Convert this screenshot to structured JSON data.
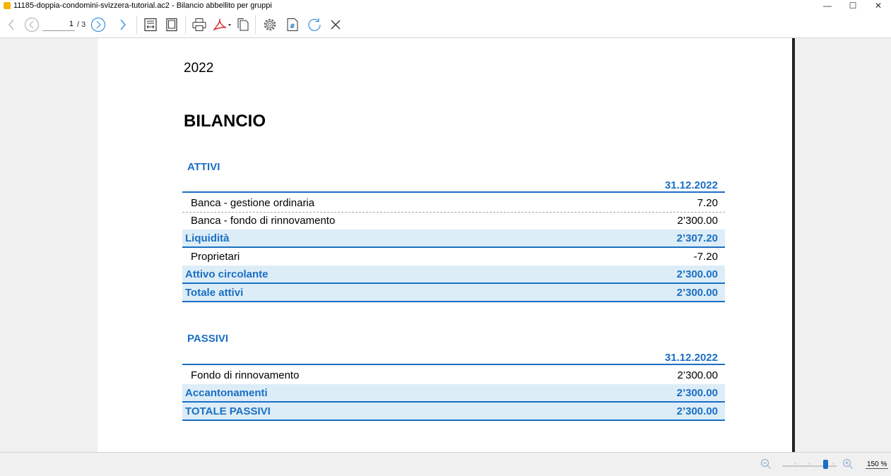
{
  "window": {
    "title": "11185-doppia-condomini-svizzera-tutorial.ac2 - Bilancio abbellito per gruppi",
    "controls": {
      "minimize": "—",
      "maximize": "☐",
      "close": "✕"
    }
  },
  "toolbar": {
    "page_current": "1",
    "page_total": "/ 3",
    "icons": [
      "back-icon",
      "previous-page-icon",
      "next-page-icon",
      "forward-icon",
      "fit-width-icon",
      "fit-page-icon",
      "print-icon",
      "pdf-export-icon",
      "copy-icon",
      "settings-icon",
      "page-number-icon",
      "refresh-icon",
      "close-icon"
    ],
    "accent": "#1a6fc4"
  },
  "document": {
    "year": "2022",
    "title": "BILANCIO",
    "attivi": {
      "heading": "ATTIVI",
      "date": "31.12.2022",
      "rows": [
        {
          "label": "Banca - gestione ordinaria",
          "value": "7.20"
        },
        {
          "label": "Banca - fondo di rinnovamento",
          "value": "2’300.00"
        },
        {
          "label": "Liquidità",
          "value": "2’307.20"
        },
        {
          "label": "Proprietari",
          "value": "-7.20"
        },
        {
          "label": "Attivo circolante",
          "value": "2’300.00"
        },
        {
          "label": "Totale attivi",
          "value": "2’300.00"
        }
      ]
    },
    "passivi": {
      "heading": "PASSIVI",
      "date": "31.12.2022",
      "rows": [
        {
          "label": "Fondo di rinnovamento",
          "value": "2’300.00"
        },
        {
          "label": "Accantonamenti",
          "value": "2’300.00"
        },
        {
          "label": "TOTALE PASSIVI",
          "value": "2’300.00"
        }
      ]
    },
    "colors": {
      "header_blue": "#1a6fc4",
      "group_background": "#ddedf7"
    }
  },
  "statusbar": {
    "zoom_level": "150 %",
    "zoom_fraction": 0.75
  }
}
